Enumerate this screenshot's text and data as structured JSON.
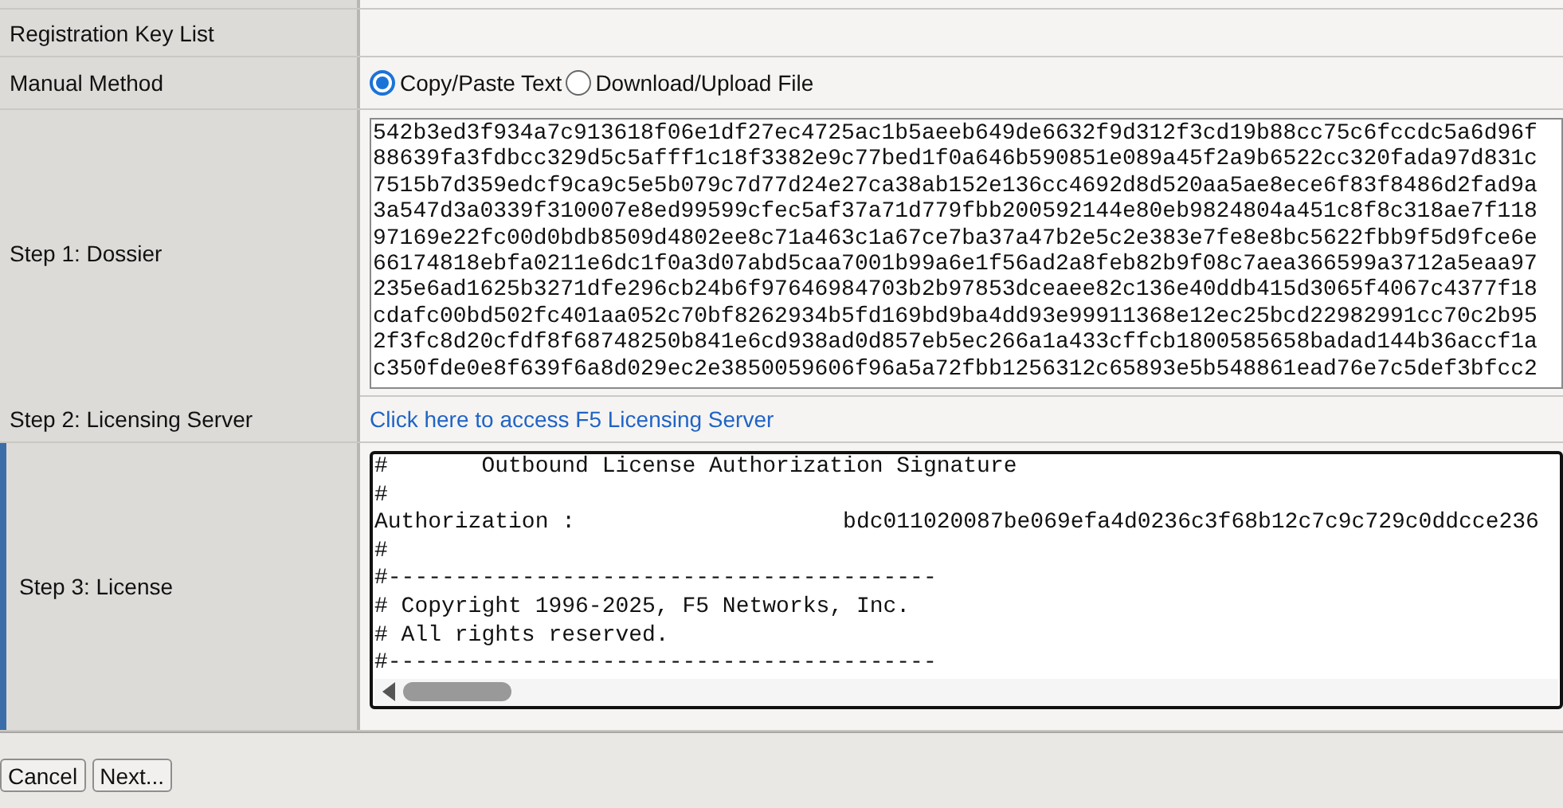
{
  "rows": [
    {
      "kind": "empty",
      "label": "Registration Key List"
    },
    {
      "kind": "radios",
      "label": "Manual Method",
      "options": [
        {
          "label": "Copy/Paste Text",
          "selected": true
        },
        {
          "label": "Download/Upload File",
          "selected": false
        }
      ]
    },
    {
      "kind": "dossier",
      "label": "Step 1: Dossier",
      "lines": [
        "542b3ed3f934a7c913618f06e1df27ec4725ac1b5aeeb649de6632f9d312f3cd19b88cc75c6fccdc5a6d96f",
        "88639fa3fdbcc329d5c5afff1c18f3382e9c77bed1f0a646b590851e089a45f2a9b6522cc320fada97d831c",
        "7515b7d359edcf9ca9c5e5b079c7d77d24e27ca38ab152e136cc4692d8d520aa5ae8ece6f83f8486d2fad9a",
        "3a547d3a0339f310007e8ed99599cfec5af37a71d779fbb200592144e80eb9824804a451c8f8c318ae7f118",
        "97169e22fc00d0bdb8509d4802ee8c71a463c1a67ce7ba37a47b2e5c2e383e7fe8e8bc5622fbb9f5d9fce6e",
        "66174818ebfa0211e6dc1f0a3d07abd5caa7001b99a6e1f56ad2a8feb82b9f08c7aea366599a3712a5eaa97",
        "235e6ad1625b3271dfe296cb24b6f97646984703b2b97853dceaee82c136e40ddb415d3065f4067c4377f18",
        "cdafc00bd502fc401aa052c70bf8262934b5fd169bd9ba4dd93e99911368e12ec25bcd22982991cc70c2b95",
        "2f3fc8d20cfdf8f68748250b841e6cd938ad0d857eb5ec266a1a433cffcb1800585658badad144b36accf1a",
        "c350fde0e8f639f6a8d029ec2e3850059606f96a5a72fbb1256312c65893e5b548861ead76e7c5def3bfcc2"
      ]
    },
    {
      "kind": "link",
      "label": "Step 2: Licensing Server",
      "link": "Click here to access F5 Licensing Server"
    },
    {
      "kind": "license",
      "label": "Step 3: License",
      "selected": true,
      "lines": [
        "#       Outbound License Authorization Signature",
        "#",
        "Authorization :                    bdc011020087be069efa4d0236c3f68b12c7c9c729c0ddcce236",
        "#",
        "#-----------------------------------------",
        "# Copyright 1996-2025, F5 Networks, Inc.",
        "# All rights reserved.",
        "#-----------------------------------------"
      ]
    }
  ],
  "buttons": [
    "Cancel",
    "Next..."
  ]
}
